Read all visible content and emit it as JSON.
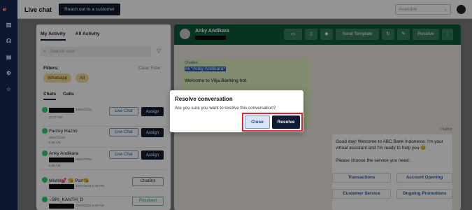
{
  "rail": {
    "logo": "e",
    "icons": [
      "analytics-icon",
      "headset-icon",
      "document-icon",
      "settings-icon",
      "star-icon"
    ]
  },
  "topbar": {
    "title": "Live chat",
    "reach_label": "Reach out to a customer",
    "status_value": "Available",
    "status_chevron": "⌄"
  },
  "left": {
    "tabs": [
      "My Activity",
      "All Activity"
    ],
    "search_placeholder": "Search user",
    "search_icon": "⌕",
    "filter_icon": "▽",
    "filters_label": "Filters:",
    "clear_filter": "Clear Filter",
    "chips": [
      "Whatsapp",
      "All"
    ],
    "subtabs": [
      "Chats",
      "Calls"
    ],
    "rows": [
      {
        "name": "",
        "date": "28/07/2024-",
        "time": "11:17 AM",
        "action": "Live Chat",
        "assign": "Assign"
      },
      {
        "name": "Fachry Hazmi",
        "date": "08/07/2024-",
        "time": "8:58 AM",
        "action": "Live Chat",
        "assign": "Assign"
      },
      {
        "name": "Anky Andikara",
        "date": "08/07/2024-",
        "time": "9:35 AM",
        "action": "Live Chat",
        "assign": "Assign"
      },
      {
        "name": "Mishti💕 😘 Parl😘",
        "date": "30/07/2024-5:48 PM",
        "time": "",
        "action": "ChatBot"
      },
      {
        "name": "~SRI_KANTH_D",
        "date": "30/07/2024-5:40 AM",
        "time": "",
        "action": "Resolved"
      }
    ]
  },
  "chat": {
    "name": "Anky Andikara",
    "header_buttons": {
      "send_template": "Send Template",
      "resolve": "Resolve"
    },
    "header_icons": [
      "id-card-icon",
      "phone-icon",
      "tag-icon",
      "refresh-icon",
      "edit-icon",
      "more-icon"
    ],
    "incoming": {
      "sender": "Chatbot",
      "greeting": "Hi *Anky Andikara*",
      "welcome": "Welcome to Vilja Banking bot."
    },
    "outgoing": {
      "label": "Chatbot",
      "p1": "Good day! Welcome to ABC Bank Indonesia. I'm your virtual assistant and I'm ready to help you 😊",
      "p2": "Please choose the service you need:",
      "services": [
        "Transactions",
        "Account Opening",
        "Customer Service",
        "Ongoing Promotions"
      ]
    }
  },
  "modal": {
    "title": "Resolve conversation",
    "question": "Are you sure you want to resolve this conversation?",
    "close": "Close",
    "resolve": "Resolve"
  },
  "colors": {
    "rail": "#0e1730",
    "primary": "#0f1a33",
    "chat_header": "#0f5c3b",
    "highlight": "#e0222f",
    "chip": "#f7d99c"
  }
}
